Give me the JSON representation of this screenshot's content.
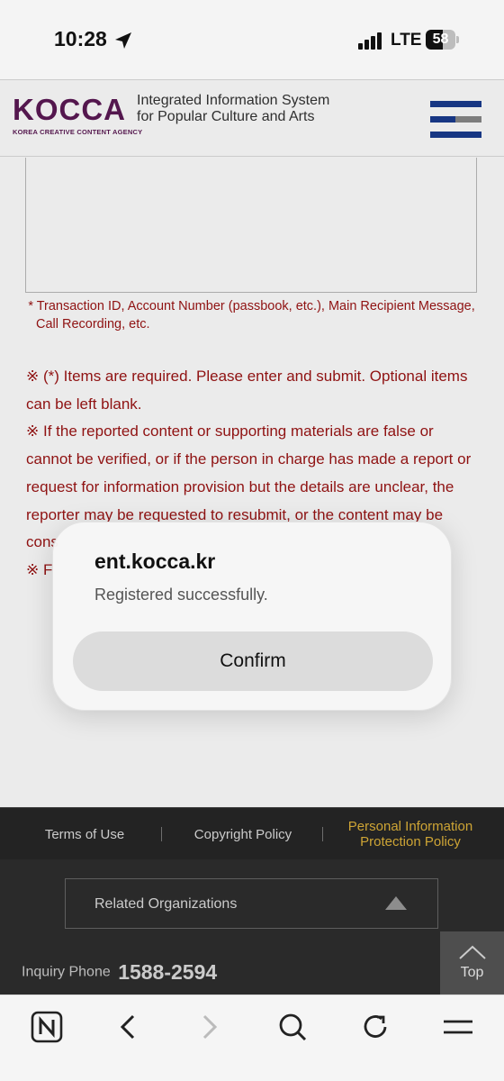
{
  "status_bar": {
    "time": "10:28",
    "network": "LTE",
    "battery_level": "58",
    "location_icon": "location-arrow-icon",
    "signal_icon": "signal-bars-icon"
  },
  "header": {
    "logo_text": "KOCCA",
    "logo_subtext": "KOREA CREATIVE CONTENT AGENCY",
    "site_title": "Integrated Information System for Popular Culture and Arts",
    "menu_icon": "hamburger-menu-icon"
  },
  "form": {
    "field_note": "* Transaction ID, Account Number (passbook, etc.), Main Recipient Message, Call Recording, etc.",
    "notices": [
      "※ (*) Items are required. Please enter and submit. Optional items can be left blank.",
      "※ If the reported content or supporting materials are false or cannot be verified, or if the person in charge has made a report or request for information provision but the details are unclear, the reporter may be requested to resubmit, or the content may be cons",
      "※ F"
    ]
  },
  "alert": {
    "title": "ent.kocca.kr",
    "message": "Registered successfully.",
    "confirm_label": "Confirm"
  },
  "footer": {
    "links": [
      "Terms of Use",
      "Copyright Policy",
      "Personal Information Protection Policy"
    ],
    "related_label": "Related Organizations",
    "inquiry_label": "Inquiry Phone",
    "inquiry_number": "1588-2594",
    "top_label": "Top"
  },
  "toolbar": {
    "icons": [
      "naver-n-icon",
      "back-arrow-icon",
      "forward-arrow-icon",
      "search-icon",
      "reload-icon",
      "menu-icon"
    ]
  },
  "colors": {
    "brand_purple": "#5c1a55",
    "menu_blue": "#1a3b8f",
    "notice_red": "#9c1414",
    "privacy_gold": "#e0b33a"
  }
}
